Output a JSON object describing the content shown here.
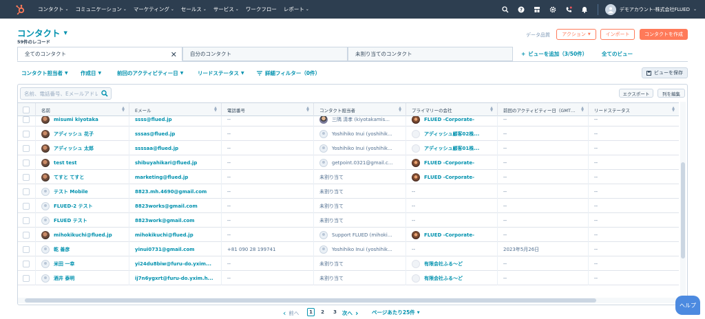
{
  "nav": {
    "items": [
      "コンタクト",
      "コミュニケーション",
      "マーケティング",
      "セールス",
      "サービス",
      "ワークフロー",
      "レポート"
    ],
    "account": "デモアカウント-株式会社FLUED"
  },
  "header": {
    "title": "コンタクト",
    "record_count": "59件のレコード",
    "data_quality": "データ品質",
    "actions_label": "アクション",
    "import_label": "インポート",
    "create_label": "コンタクトを作成"
  },
  "tabs": {
    "items": [
      "全てのコンタクト",
      "自分のコンタクト",
      "未割り当てのコンタクト"
    ],
    "add_view": "ビューを追加（3/50件）",
    "all_views": "全てのビュー"
  },
  "filters": {
    "items": [
      "コンタクト担当者",
      "作成日",
      "前回のアクティビティー日",
      "リードステータス"
    ],
    "advanced": "詳細フィルター（0件）",
    "save_view": "ビューを保存"
  },
  "table": {
    "search_placeholder": "名前、電話番号、Eメールアドレス",
    "export_label": "エクスポート",
    "edit_columns_label": "列を編集",
    "columns": [
      "名前",
      "Eメール",
      "電話番号",
      "コンタクト担当者",
      "プライマリーの会社",
      "前回のアクティビティー日（GMT…",
      "リードステータス"
    ],
    "rows": [
      {
        "name": "misumi kiyotaka",
        "avatar": "photo",
        "email": "ssss@flued.jp",
        "phone": "--",
        "owner": "三隅 清孝 (kiyotakamis...",
        "owner_av": "person",
        "company": "FLUED -Corporate-",
        "company_av": "company",
        "company_link": true,
        "activity": "--",
        "lead": "--"
      },
      {
        "name": "アディッシュ 花子",
        "avatar": "photo",
        "email": "sssas@flued.jp",
        "phone": "--",
        "owner": "Yoshihiko Inui (yoshihik...",
        "owner_av": "blank",
        "company": "アディッシュ顧客02株...",
        "company_av": "company-blank",
        "company_link": true,
        "activity": "--",
        "lead": "--"
      },
      {
        "name": "アディッシュ 太郎",
        "avatar": "photo",
        "email": "ssssaa@flued.jp",
        "phone": "--",
        "owner": "Yoshihiko Inui (yoshihik...",
        "owner_av": "blank",
        "company": "アディッシュ顧客01株...",
        "company_av": "company-blank",
        "company_link": true,
        "activity": "--",
        "lead": "--"
      },
      {
        "name": "test test",
        "avatar": "photo",
        "email": "shibuyahikari@flued.jp",
        "phone": "--",
        "owner": "getpoint.0321@gmail.c...",
        "owner_av": "blank",
        "company": "FLUED -Corporate-",
        "company_av": "company",
        "company_link": true,
        "activity": "--",
        "lead": "--"
      },
      {
        "name": "てすと てすと",
        "avatar": "photo",
        "email": "marketing@flued.jp",
        "phone": "--",
        "owner": "未割り当て",
        "owner_av": "",
        "company": "FLUED -Corporate-",
        "company_av": "company",
        "company_link": true,
        "activity": "--",
        "lead": "--"
      },
      {
        "name": "テスト Mobile",
        "avatar": "blank",
        "email": "8823.mh.4690@gmail.com",
        "phone": "--",
        "owner": "未割り当て",
        "owner_av": "",
        "company": "--",
        "company_av": "",
        "company_link": false,
        "activity": "--",
        "lead": "--"
      },
      {
        "name": "FLUED-2 テスト",
        "avatar": "blank",
        "email": "8823works@gmail.com",
        "phone": "--",
        "owner": "未割り当て",
        "owner_av": "",
        "company": "--",
        "company_av": "",
        "company_link": false,
        "activity": "--",
        "lead": "--"
      },
      {
        "name": "FLUED テスト",
        "avatar": "blank",
        "email": "8823work@gmail.com",
        "phone": "--",
        "owner": "未割り当て",
        "owner_av": "",
        "company": "--",
        "company_av": "",
        "company_link": false,
        "activity": "--",
        "lead": "--"
      },
      {
        "name": "mihokikuchi@flued.jp",
        "avatar": "photo",
        "email": "mihokikuchi@flued.jp",
        "phone": "--",
        "owner": "Support FLUED (mihoki...",
        "owner_av": "blank",
        "company": "FLUED -Corporate-",
        "company_av": "company",
        "company_link": true,
        "activity": "--",
        "lead": "--"
      },
      {
        "name": "乾 善彦",
        "avatar": "blank",
        "email": "yinui0731@gmail.com",
        "phone": "+81 090 28 199741",
        "owner": "Yoshihiko Inui (yoshihik...",
        "owner_av": "blank",
        "company": "--",
        "company_av": "",
        "company_link": false,
        "activity": "2023年5月26日",
        "lead": "--"
      },
      {
        "name": "米田 一幸",
        "avatar": "blank",
        "email": "yi24du8biw@furu-do.yxim...",
        "phone": "--",
        "owner": "未割り当て",
        "owner_av": "",
        "company": "有限会社ふる～ど",
        "company_av": "company-blank",
        "company_link": true,
        "activity": "--",
        "lead": "--"
      },
      {
        "name": "酒井 泰明",
        "avatar": "blank",
        "email": "ij7n6ygxrt@furu-do.yxim.h...",
        "phone": "--",
        "owner": "未割り当て",
        "owner_av": "",
        "company": "有限会社ふる～ど",
        "company_av": "company-blank",
        "company_link": true,
        "activity": "--",
        "lead": "--"
      }
    ]
  },
  "pagination": {
    "prev": "前へ",
    "pages": [
      "1",
      "2",
      "3"
    ],
    "current": "1",
    "next": "次へ",
    "per_page": "ページあたり25件"
  },
  "help_label": "ヘルプ",
  "colors": {
    "nav_bg": "#2d3e50",
    "accent": "#0091ae",
    "brand_orange": "#ff7a59"
  }
}
